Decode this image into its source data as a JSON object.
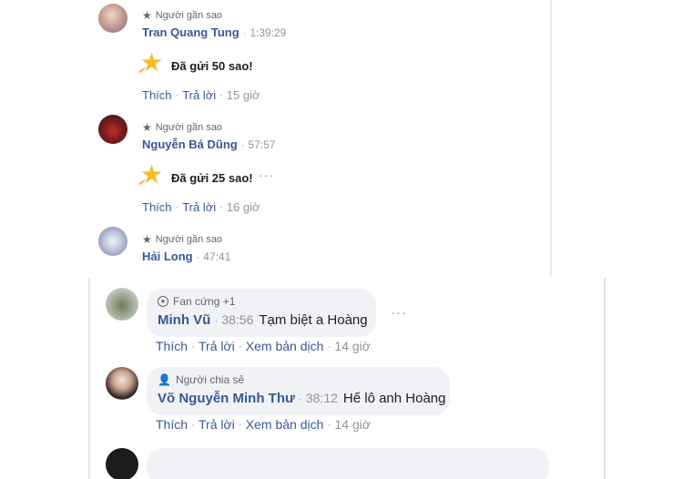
{
  "top_comments": [
    {
      "badge": "Người gần sao",
      "name": "Tran Quang Tung",
      "time": "1:39:29",
      "star_text": "Đã gửi 50 sao!",
      "like": "Thích",
      "reply": "Trả lời",
      "ago": "15 giờ"
    },
    {
      "badge": "Người gần sao",
      "name": "Nguyễn Bá Dũng",
      "time": "57:57",
      "star_text": "Đã gửi 25 sao!",
      "like": "Thích",
      "reply": "Trả lời",
      "ago": "16 giờ"
    },
    {
      "badge": "Người gần sao",
      "name": "Hải Long",
      "time": "47:41"
    }
  ],
  "bottom_comments": [
    {
      "badge": "Fan cứng +1",
      "name": "Minh Vũ",
      "time": "38:56",
      "text": "Tạm biệt a Hoàng",
      "like": "Thích",
      "reply": "Trả lời",
      "translate": "Xem bản dịch",
      "ago": "14 giờ"
    },
    {
      "badge": "Người chia sẻ",
      "name": "Võ Nguyễn Minh Thư",
      "time": "38:12",
      "text": "Hế lô anh Hoàng",
      "like": "Thích",
      "reply": "Trả lời",
      "translate": "Xem bản dịch",
      "ago": "14 giờ"
    }
  ],
  "separator": "·",
  "more_label": "···",
  "icons": {
    "badge_star": "star-icon",
    "sent_star": "shooting-star-icon",
    "fan_badge": "fan-badge-icon",
    "sharer_badge": "sharer-icon"
  },
  "colors": {
    "name": "#385898",
    "muted": "#90949c",
    "bubble": "#f0f2f5",
    "star": "#f7b928"
  }
}
